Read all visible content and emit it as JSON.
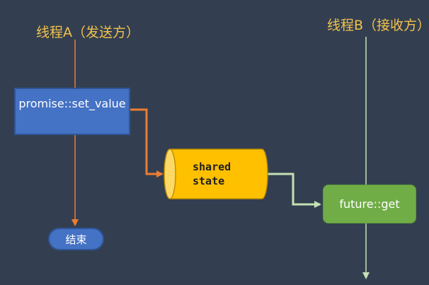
{
  "threads": {
    "sender_title": "线程A（发送方）",
    "receiver_title": "线程B（接收方）"
  },
  "nodes": {
    "set_value": "promise::set_value",
    "shared_state_line1": "shared",
    "shared_state_line2": "state",
    "future_get": "future::get",
    "end": "结束"
  },
  "colors": {
    "background": "#333f50",
    "title_text": "#f2c14e",
    "sender_line": "#ed7d31",
    "receiver_line": "#c5e0b4",
    "blue_box": "#4472c4",
    "shared_state": "#ffc000",
    "green_box": "#70ad47"
  }
}
